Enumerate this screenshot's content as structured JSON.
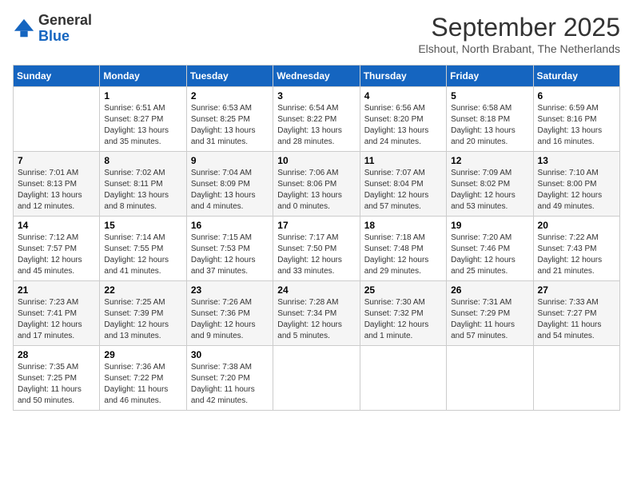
{
  "logo": {
    "general": "General",
    "blue": "Blue"
  },
  "header": {
    "month_year": "September 2025",
    "location": "Elshout, North Brabant, The Netherlands"
  },
  "weekdays": [
    "Sunday",
    "Monday",
    "Tuesday",
    "Wednesday",
    "Thursday",
    "Friday",
    "Saturday"
  ],
  "weeks": [
    [
      {
        "day": "",
        "sunrise": "",
        "sunset": "",
        "daylight": ""
      },
      {
        "day": "1",
        "sunrise": "Sunrise: 6:51 AM",
        "sunset": "Sunset: 8:27 PM",
        "daylight": "Daylight: 13 hours and 35 minutes."
      },
      {
        "day": "2",
        "sunrise": "Sunrise: 6:53 AM",
        "sunset": "Sunset: 8:25 PM",
        "daylight": "Daylight: 13 hours and 31 minutes."
      },
      {
        "day": "3",
        "sunrise": "Sunrise: 6:54 AM",
        "sunset": "Sunset: 8:22 PM",
        "daylight": "Daylight: 13 hours and 28 minutes."
      },
      {
        "day": "4",
        "sunrise": "Sunrise: 6:56 AM",
        "sunset": "Sunset: 8:20 PM",
        "daylight": "Daylight: 13 hours and 24 minutes."
      },
      {
        "day": "5",
        "sunrise": "Sunrise: 6:58 AM",
        "sunset": "Sunset: 8:18 PM",
        "daylight": "Daylight: 13 hours and 20 minutes."
      },
      {
        "day": "6",
        "sunrise": "Sunrise: 6:59 AM",
        "sunset": "Sunset: 8:16 PM",
        "daylight": "Daylight: 13 hours and 16 minutes."
      }
    ],
    [
      {
        "day": "7",
        "sunrise": "Sunrise: 7:01 AM",
        "sunset": "Sunset: 8:13 PM",
        "daylight": "Daylight: 13 hours and 12 minutes."
      },
      {
        "day": "8",
        "sunrise": "Sunrise: 7:02 AM",
        "sunset": "Sunset: 8:11 PM",
        "daylight": "Daylight: 13 hours and 8 minutes."
      },
      {
        "day": "9",
        "sunrise": "Sunrise: 7:04 AM",
        "sunset": "Sunset: 8:09 PM",
        "daylight": "Daylight: 13 hours and 4 minutes."
      },
      {
        "day": "10",
        "sunrise": "Sunrise: 7:06 AM",
        "sunset": "Sunset: 8:06 PM",
        "daylight": "Daylight: 13 hours and 0 minutes."
      },
      {
        "day": "11",
        "sunrise": "Sunrise: 7:07 AM",
        "sunset": "Sunset: 8:04 PM",
        "daylight": "Daylight: 12 hours and 57 minutes."
      },
      {
        "day": "12",
        "sunrise": "Sunrise: 7:09 AM",
        "sunset": "Sunset: 8:02 PM",
        "daylight": "Daylight: 12 hours and 53 minutes."
      },
      {
        "day": "13",
        "sunrise": "Sunrise: 7:10 AM",
        "sunset": "Sunset: 8:00 PM",
        "daylight": "Daylight: 12 hours and 49 minutes."
      }
    ],
    [
      {
        "day": "14",
        "sunrise": "Sunrise: 7:12 AM",
        "sunset": "Sunset: 7:57 PM",
        "daylight": "Daylight: 12 hours and 45 minutes."
      },
      {
        "day": "15",
        "sunrise": "Sunrise: 7:14 AM",
        "sunset": "Sunset: 7:55 PM",
        "daylight": "Daylight: 12 hours and 41 minutes."
      },
      {
        "day": "16",
        "sunrise": "Sunrise: 7:15 AM",
        "sunset": "Sunset: 7:53 PM",
        "daylight": "Daylight: 12 hours and 37 minutes."
      },
      {
        "day": "17",
        "sunrise": "Sunrise: 7:17 AM",
        "sunset": "Sunset: 7:50 PM",
        "daylight": "Daylight: 12 hours and 33 minutes."
      },
      {
        "day": "18",
        "sunrise": "Sunrise: 7:18 AM",
        "sunset": "Sunset: 7:48 PM",
        "daylight": "Daylight: 12 hours and 29 minutes."
      },
      {
        "day": "19",
        "sunrise": "Sunrise: 7:20 AM",
        "sunset": "Sunset: 7:46 PM",
        "daylight": "Daylight: 12 hours and 25 minutes."
      },
      {
        "day": "20",
        "sunrise": "Sunrise: 7:22 AM",
        "sunset": "Sunset: 7:43 PM",
        "daylight": "Daylight: 12 hours and 21 minutes."
      }
    ],
    [
      {
        "day": "21",
        "sunrise": "Sunrise: 7:23 AM",
        "sunset": "Sunset: 7:41 PM",
        "daylight": "Daylight: 12 hours and 17 minutes."
      },
      {
        "day": "22",
        "sunrise": "Sunrise: 7:25 AM",
        "sunset": "Sunset: 7:39 PM",
        "daylight": "Daylight: 12 hours and 13 minutes."
      },
      {
        "day": "23",
        "sunrise": "Sunrise: 7:26 AM",
        "sunset": "Sunset: 7:36 PM",
        "daylight": "Daylight: 12 hours and 9 minutes."
      },
      {
        "day": "24",
        "sunrise": "Sunrise: 7:28 AM",
        "sunset": "Sunset: 7:34 PM",
        "daylight": "Daylight: 12 hours and 5 minutes."
      },
      {
        "day": "25",
        "sunrise": "Sunrise: 7:30 AM",
        "sunset": "Sunset: 7:32 PM",
        "daylight": "Daylight: 12 hours and 1 minute."
      },
      {
        "day": "26",
        "sunrise": "Sunrise: 7:31 AM",
        "sunset": "Sunset: 7:29 PM",
        "daylight": "Daylight: 11 hours and 57 minutes."
      },
      {
        "day": "27",
        "sunrise": "Sunrise: 7:33 AM",
        "sunset": "Sunset: 7:27 PM",
        "daylight": "Daylight: 11 hours and 54 minutes."
      }
    ],
    [
      {
        "day": "28",
        "sunrise": "Sunrise: 7:35 AM",
        "sunset": "Sunset: 7:25 PM",
        "daylight": "Daylight: 11 hours and 50 minutes."
      },
      {
        "day": "29",
        "sunrise": "Sunrise: 7:36 AM",
        "sunset": "Sunset: 7:22 PM",
        "daylight": "Daylight: 11 hours and 46 minutes."
      },
      {
        "day": "30",
        "sunrise": "Sunrise: 7:38 AM",
        "sunset": "Sunset: 7:20 PM",
        "daylight": "Daylight: 11 hours and 42 minutes."
      },
      {
        "day": "",
        "sunrise": "",
        "sunset": "",
        "daylight": ""
      },
      {
        "day": "",
        "sunrise": "",
        "sunset": "",
        "daylight": ""
      },
      {
        "day": "",
        "sunrise": "",
        "sunset": "",
        "daylight": ""
      },
      {
        "day": "",
        "sunrise": "",
        "sunset": "",
        "daylight": ""
      }
    ]
  ]
}
